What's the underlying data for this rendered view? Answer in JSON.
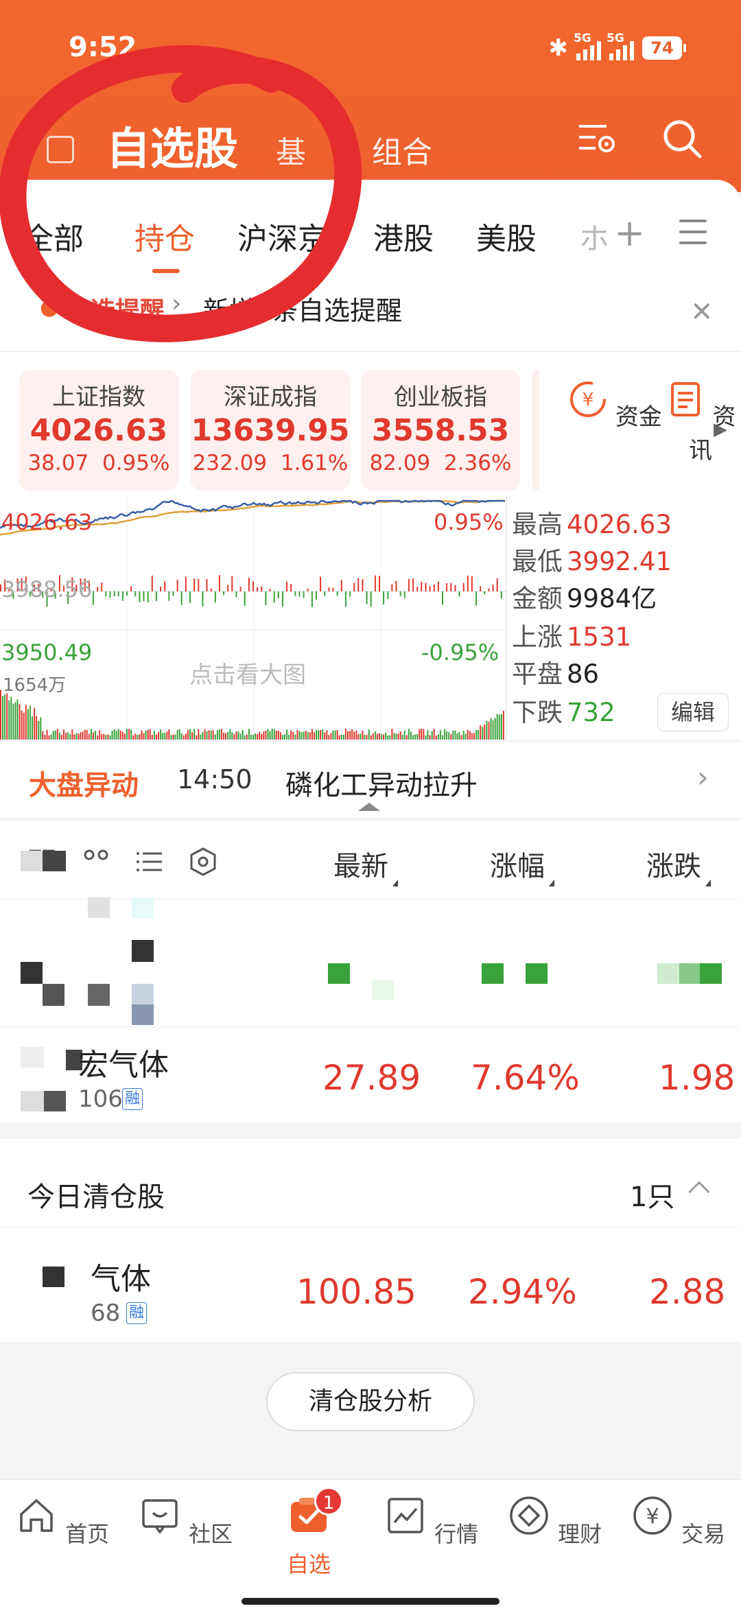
{
  "status_bar": {
    "time": "9:52",
    "battery": "74",
    "net1": "5G",
    "net2": "5G"
  },
  "header": {
    "title": "自选股",
    "fund_tab": "基",
    "combo_tab": "组合"
  },
  "tabs": [
    {
      "label": "全部"
    },
    {
      "label": "持仓"
    },
    {
      "label": "沪深京"
    },
    {
      "label": "港股"
    },
    {
      "label": "美股"
    },
    {
      "label": "ホ"
    }
  ],
  "alert": {
    "label": "自选提醒",
    "text": "新增1条自选提醒"
  },
  "indices": [
    {
      "name": "上证指数",
      "value": "4026.63",
      "change": "38.07",
      "pct": "0.95%"
    },
    {
      "name": "深证成指",
      "value": "13639.95",
      "change": "232.09",
      "pct": "1.61%"
    },
    {
      "name": "创业板指",
      "value": "3558.53",
      "change": "82.09",
      "pct": "2.36%"
    }
  ],
  "side_buttons": {
    "fund": "资金",
    "news": "资讯"
  },
  "chart": {
    "high_label": "4026.63",
    "low_label": "3950.49",
    "mid_label": "3988.56",
    "pct_up": "0.95%",
    "pct_down": "-0.95%",
    "volume": "1654万",
    "big_chart": "点击看大图",
    "stats": {
      "high_k": "最高",
      "high_v": "4026.63",
      "low_k": "最低",
      "low_v": "3992.41",
      "amt_k": "金额",
      "amt_v": "9984亿",
      "up_k": "上涨",
      "up_v": "1531",
      "flat_k": "平盘",
      "flat_v": "86",
      "down_k": "下跌",
      "down_v": "732"
    },
    "edit": "编辑",
    "colors": {
      "price": "#3a5fa8",
      "avg": "#e0a13a",
      "up": "#e0392e",
      "down": "#3aa23a"
    }
  },
  "movement": {
    "label": "大盘异动",
    "time": "14:50",
    "text": "磷化工异动拉升"
  },
  "table_head": {
    "latest": "最新",
    "change_pct": "涨幅",
    "change": "涨跌"
  },
  "holdings": [
    {
      "name": "宏气体",
      "code": "106",
      "tag": "融",
      "latest": "27.89",
      "pct": "7.64%",
      "change": "1.98"
    }
  ],
  "cleared": {
    "title": "今日清仓股",
    "count": "1只",
    "items": [
      {
        "name": "气体",
        "code": "68",
        "tag": "融",
        "latest": "100.85",
        "pct": "2.94%",
        "change": "2.88"
      }
    ]
  },
  "analysis_button": "清仓股分析",
  "bottom_nav": [
    {
      "label": "首页",
      "icon": "home-icon"
    },
    {
      "label": "社区",
      "icon": "community-icon"
    },
    {
      "label": "自选",
      "icon": "watchlist-icon",
      "badge": "1"
    },
    {
      "label": "行情",
      "icon": "market-icon"
    },
    {
      "label": "理财",
      "icon": "wealth-icon"
    },
    {
      "label": "交易",
      "icon": "trade-icon"
    }
  ]
}
